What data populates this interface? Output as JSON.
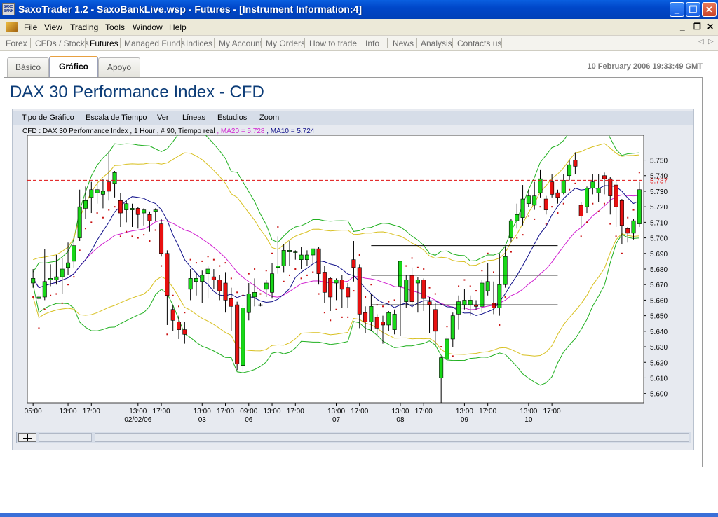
{
  "window": {
    "title": "SaxoTrader 1.2 - SaxoBankLive.wsp - Futures - [Instrument Information:4]",
    "icon_text": "SAXO BANK",
    "controls": {
      "minimize": "_",
      "maximize": "❐",
      "close": "✕"
    }
  },
  "menubar": {
    "items": [
      "File",
      "View",
      "Trading",
      "Tools",
      "Window",
      "Help"
    ],
    "mdi_controls": {
      "minimize": "_",
      "restore": "❐",
      "close": "✕"
    }
  },
  "navbar": {
    "items": [
      "Forex",
      "CFDs / Stocks",
      "Futures",
      "Managed Funds",
      "Indices",
      "My Account",
      "My Orders",
      "How to trade",
      "Info",
      "News",
      "Analysis",
      "Contacts us"
    ],
    "active": "Futures",
    "arrows": {
      "left": "◁",
      "right": "▷"
    }
  },
  "tabs": [
    "Básico",
    "Gráfico",
    "Apoyo"
  ],
  "active_tab": "Gráfico",
  "timestamp": "10 February 2006 19:33:49 GMT",
  "instrument_title": "DAX 30 Performance Index - CFD",
  "chart_menu": [
    "Tipo de Gráfico",
    "Escala de Tiempo",
    "Ver",
    "Líneas",
    "Estudios",
    "Zoom"
  ],
  "legend": {
    "main": "CFD : DAX 30 Performance Index , 1 Hour , # 90, Tiempo real",
    "ma20": ", MA20 = 5.728",
    "ma10": ", MA10 = 5.724"
  },
  "colors": {
    "up": "#18d818",
    "down": "#e81010",
    "ma20": "#d020d0",
    "ma10": "#10108a",
    "bollinger_outer": "#20b020",
    "bollinger_inner": "#d8c020",
    "sar": "#c81010",
    "ref_line": "#e01010"
  },
  "chart_data": {
    "type": "candlestick",
    "ylim": [
      5.594,
      5.766
    ],
    "y_ticks": [
      5.6,
      5.61,
      5.62,
      5.63,
      5.64,
      5.65,
      5.66,
      5.67,
      5.68,
      5.69,
      5.7,
      5.71,
      5.72,
      5.73,
      5.74,
      5.75
    ],
    "y_tick_labels": [
      "5.600",
      "5.610",
      "5.620",
      "5.630",
      "5.640",
      "5.650",
      "5.660",
      "5.670",
      "5.680",
      "5.690",
      "5.700",
      "5.710",
      "5.720",
      "5.730",
      "5.740",
      "5.750"
    ],
    "reference_value": 5.737,
    "reference_label": "5.737",
    "x_axis": {
      "hours": [
        {
          "bar": 0,
          "label": "05:00"
        },
        {
          "bar": 6,
          "label": "13:00"
        },
        {
          "bar": 10,
          "label": "17:00"
        },
        {
          "bar": 18,
          "label": "13:00"
        },
        {
          "bar": 22,
          "label": "17:00"
        },
        {
          "bar": 29,
          "label": "13:00"
        },
        {
          "bar": 33,
          "label": "17:00"
        },
        {
          "bar": 37,
          "label": "09:00"
        },
        {
          "bar": 41,
          "label": "13:00"
        },
        {
          "bar": 45,
          "label": "17:00"
        },
        {
          "bar": 52,
          "label": "13:00"
        },
        {
          "bar": 56,
          "label": "17:00"
        },
        {
          "bar": 63,
          "label": "13:00"
        },
        {
          "bar": 67,
          "label": "17:00"
        },
        {
          "bar": 74,
          "label": "13:00"
        },
        {
          "bar": 78,
          "label": "17:00"
        },
        {
          "bar": 85,
          "label": "13:00"
        },
        {
          "bar": 89,
          "label": "17:00"
        }
      ],
      "dates": [
        {
          "bar": 18,
          "label": "02/02/06"
        },
        {
          "bar": 29,
          "label": "03"
        },
        {
          "bar": 37,
          "label": "06"
        },
        {
          "bar": 52,
          "label": "07"
        },
        {
          "bar": 63,
          "label": "08"
        },
        {
          "bar": 74,
          "label": "09"
        },
        {
          "bar": 85,
          "label": "10"
        }
      ]
    },
    "horizontal_lines": [
      {
        "value": 5.695,
        "from_bar": 58,
        "to_bar": 90
      },
      {
        "value": 5.676,
        "from_bar": 58,
        "to_bar": 90
      },
      {
        "value": 5.657,
        "from_bar": 58,
        "to_bar": 90
      }
    ],
    "candles": [
      [
        5.671,
        5.674,
        5.668,
        5.68
      ],
      [
        5.661,
        5.662,
        5.648,
        5.664
      ],
      [
        5.662,
        5.672,
        5.66,
        5.693
      ],
      [
        5.673,
        5.674,
        5.669,
        5.683
      ],
      [
        5.673,
        5.675,
        5.67,
        5.689
      ],
      [
        5.675,
        5.68,
        5.664,
        5.687
      ],
      [
        5.681,
        5.684,
        5.676,
        5.697
      ],
      [
        5.685,
        5.695,
        5.681,
        5.701
      ],
      [
        5.7,
        5.72,
        5.698,
        5.731
      ],
      [
        5.719,
        5.724,
        5.712,
        5.733
      ],
      [
        5.726,
        5.731,
        5.716,
        5.736
      ],
      [
        5.729,
        5.731,
        5.722,
        5.737
      ],
      [
        5.728,
        5.73,
        5.719,
        5.738
      ],
      [
        5.736,
        5.73,
        5.724,
        5.756
      ],
      [
        5.735,
        5.742,
        5.726,
        5.743
      ],
      [
        5.724,
        5.716,
        5.707,
        5.729
      ],
      [
        5.718,
        5.722,
        5.71,
        5.724
      ],
      [
        5.718,
        5.719,
        5.707,
        5.722
      ],
      [
        5.719,
        5.715,
        5.706,
        5.72
      ],
      [
        5.716,
        5.718,
        5.708,
        5.719
      ],
      [
        5.715,
        5.711,
        5.704,
        5.717
      ],
      [
        5.717,
        5.718,
        5.711,
        5.719
      ],
      [
        5.709,
        5.69,
        5.688,
        5.712
      ],
      [
        5.69,
        5.663,
        5.644,
        5.692
      ],
      [
        5.654,
        5.647,
        5.64,
        5.657
      ],
      [
        5.646,
        5.641,
        5.635,
        5.65
      ],
      [
        5.641,
        5.638,
        5.632,
        5.646
      ],
      [
        5.667,
        5.674,
        5.66,
        5.68
      ],
      [
        5.672,
        5.674,
        5.663,
        5.678
      ],
      [
        5.672,
        5.676,
        5.658,
        5.679
      ],
      [
        5.677,
        5.68,
        5.661,
        5.682
      ],
      [
        5.675,
        5.673,
        5.667,
        5.68
      ],
      [
        5.673,
        5.666,
        5.66,
        5.676
      ],
      [
        5.671,
        5.66,
        5.652,
        5.678
      ],
      [
        5.661,
        5.656,
        5.64,
        5.668
      ],
      [
        5.657,
        5.619,
        5.615,
        5.659
      ],
      [
        5.618,
        5.655,
        5.614,
        5.657
      ],
      [
        5.652,
        5.664,
        5.647,
        5.671
      ],
      [
        5.662,
        5.665,
        5.656,
        5.674
      ],
      [
        5.657,
        5.657,
        5.656,
        5.658
      ],
      [
        5.667,
        5.671,
        5.662,
        5.673
      ],
      [
        5.665,
        5.677,
        5.661,
        5.684
      ],
      [
        5.681,
        5.682,
        5.677,
        5.701
      ],
      [
        5.682,
        5.692,
        5.678,
        5.696
      ],
      [
        5.691,
        5.692,
        5.682,
        5.698
      ],
      [
        5.691,
        5.691,
        5.686,
        5.692
      ],
      [
        5.686,
        5.689,
        5.68,
        5.694
      ],
      [
        5.686,
        5.689,
        5.682,
        5.692
      ],
      [
        5.689,
        5.693,
        5.684,
        5.693
      ],
      [
        5.693,
        5.677,
        5.67,
        5.694
      ],
      [
        5.678,
        5.665,
        5.658,
        5.682
      ],
      [
        5.674,
        5.662,
        5.653,
        5.675
      ],
      [
        5.671,
        5.673,
        5.66,
        5.674
      ],
      [
        5.673,
        5.667,
        5.655,
        5.676
      ],
      [
        5.668,
        5.662,
        5.655,
        5.671
      ],
      [
        5.686,
        5.681,
        5.672,
        5.698
      ],
      [
        5.681,
        5.651,
        5.642,
        5.683
      ],
      [
        5.652,
        5.646,
        5.639,
        5.656
      ],
      [
        5.646,
        5.656,
        5.64,
        5.664
      ],
      [
        5.649,
        5.642,
        5.637,
        5.651
      ],
      [
        5.646,
        5.644,
        5.632,
        5.65
      ],
      [
        5.644,
        5.652,
        5.64,
        5.653
      ],
      [
        5.641,
        5.651,
        5.638,
        5.654
      ],
      [
        5.669,
        5.685,
        5.637,
        5.671
      ],
      [
        5.659,
        5.673,
        5.655,
        5.676
      ],
      [
        5.676,
        5.659,
        5.655,
        5.681
      ],
      [
        5.671,
        5.673,
        5.652,
        5.675
      ],
      [
        5.673,
        5.661,
        5.653,
        5.674
      ],
      [
        5.659,
        5.657,
        5.639,
        5.662
      ],
      [
        5.654,
        5.64,
        5.631,
        5.658
      ],
      [
        5.61,
        5.623,
        5.594,
        5.624
      ],
      [
        5.622,
        5.635,
        5.619,
        5.637
      ],
      [
        5.635,
        5.65,
        5.63,
        5.652
      ],
      [
        5.651,
        5.659,
        5.641,
        5.663
      ],
      [
        5.657,
        5.66,
        5.654,
        5.667
      ],
      [
        5.657,
        5.66,
        5.65,
        5.663
      ],
      [
        5.657,
        5.656,
        5.654,
        5.66
      ],
      [
        5.656,
        5.671,
        5.652,
        5.673
      ],
      [
        5.666,
        5.672,
        5.663,
        5.684
      ],
      [
        5.658,
        5.655,
        5.651,
        5.672
      ],
      [
        5.655,
        5.67,
        5.65,
        5.69
      ],
      [
        5.67,
        5.688,
        5.668,
        5.694
      ],
      [
        5.7,
        5.711,
        5.697,
        5.712
      ],
      [
        5.711,
        5.715,
        5.706,
        5.722
      ],
      [
        5.713,
        5.725,
        5.708,
        5.734
      ],
      [
        5.722,
        5.727,
        5.72,
        5.731
      ],
      [
        5.721,
        5.727,
        5.718,
        5.736
      ],
      [
        5.729,
        5.738,
        5.726,
        5.744
      ]
    ],
    "candles_tail": [
      [
        5.725,
        5.718,
        5.715,
        5.727
      ],
      [
        5.736,
        5.728,
        5.726,
        5.741
      ],
      [
        5.729,
        5.726,
        5.722,
        5.731
      ],
      [
        5.729,
        5.737,
        5.728,
        5.741
      ],
      [
        5.74,
        5.747,
        5.737,
        5.75
      ],
      [
        5.75,
        5.746,
        5.741,
        5.755
      ],
      [
        5.721,
        5.714,
        5.707,
        5.723
      ],
      [
        5.72,
        5.732,
        5.716,
        5.733
      ],
      [
        5.732,
        5.736,
        5.728,
        5.741
      ],
      [
        5.729,
        5.732,
        5.723,
        5.741
      ],
      [
        5.74,
        5.738,
        5.728,
        5.742
      ],
      [
        5.738,
        5.727,
        5.715,
        5.739
      ],
      [
        5.734,
        5.72,
        5.707,
        5.737
      ],
      [
        5.724,
        5.708,
        5.696,
        5.725
      ],
      [
        5.706,
        5.703,
        5.697,
        5.707
      ],
      [
        5.703,
        5.711,
        5.699,
        5.712
      ],
      [
        5.709,
        5.731,
        5.707,
        5.736
      ]
    ]
  }
}
